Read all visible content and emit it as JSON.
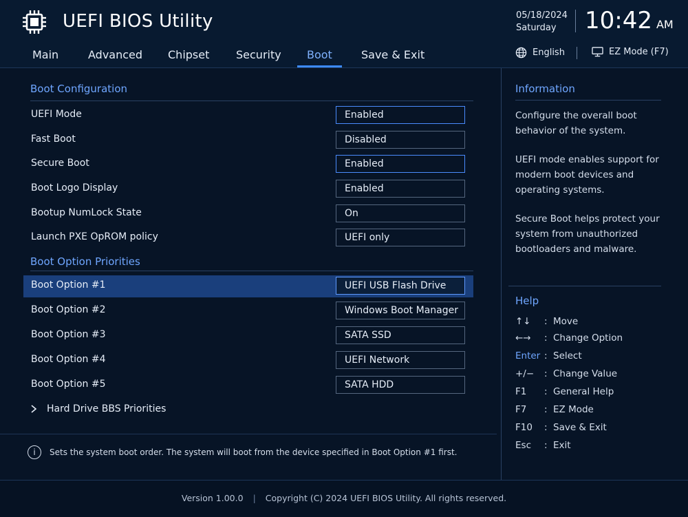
{
  "header": {
    "title": "UEFI BIOS Utility",
    "date": "05/18/2024",
    "day": "Saturday",
    "time": "10:42",
    "ampm": "AM",
    "language": "English",
    "ez_mode": "EZ Mode (F7)",
    "chip_icon": "cpu-chip-icon",
    "globe_icon": "globe-icon",
    "monitor_icon": "monitor-icon"
  },
  "tabs": [
    {
      "label": "Main",
      "active": false
    },
    {
      "label": "Advanced",
      "active": false
    },
    {
      "label": "Chipset",
      "active": false
    },
    {
      "label": "Security",
      "active": false
    },
    {
      "label": "Boot",
      "active": true
    },
    {
      "label": "Save & Exit",
      "active": false
    }
  ],
  "main": {
    "boot_config_title": "Boot Configuration",
    "settings": [
      {
        "label": "UEFI Mode",
        "value": "Enabled"
      },
      {
        "label": "Fast Boot",
        "value": "Disabled"
      },
      {
        "label": "Secure Boot",
        "value": "Enabled"
      },
      {
        "label": "Boot Logo Display",
        "value": "Enabled"
      },
      {
        "label": "Bootup NumLock State",
        "value": "On"
      },
      {
        "label": "Launch PXE OpROM policy",
        "value": "UEFI only"
      }
    ],
    "priorities_title": "Boot Option Priorities",
    "boot_options": [
      {
        "label": "Boot Option #1",
        "value": "UEFI USB Flash Drive",
        "selected": true
      },
      {
        "label": "Boot Option #2",
        "value": "Windows Boot Manager"
      },
      {
        "label": "Boot Option #3",
        "value": "SATA SSD"
      },
      {
        "label": "Boot Option #4",
        "value": "UEFI Network"
      },
      {
        "label": "Boot Option #5",
        "value": "SATA HDD"
      }
    ],
    "submenu": "Hard Drive BBS Priorities",
    "hint": "Sets the system boot order. The system will boot from the device specified in Boot Option #1 first."
  },
  "side": {
    "info_title": "Information",
    "info_paragraphs": [
      "Configure the overall boot behavior of the system.",
      "UEFI mode enables support for modern boot devices and operating systems.",
      "Secure Boot helps protect your system from unauthorized bootloaders and malware."
    ],
    "help_title": "Help",
    "help": [
      {
        "key": "↑↓",
        "desc": "Move"
      },
      {
        "key": "←→",
        "desc": "Change Option"
      },
      {
        "key": "Enter",
        "desc": "Select"
      },
      {
        "key": "+/−",
        "desc": "Change Value"
      },
      {
        "key": "F1",
        "desc": "General Help"
      },
      {
        "key": "F7",
        "desc": "EZ Mode"
      },
      {
        "key": "F10",
        "desc": "Save & Exit"
      },
      {
        "key": "Esc",
        "desc": "Exit"
      }
    ]
  },
  "footer": {
    "version": "Version 1.00.0",
    "copyright": "Copyright (C) 2024 UEFI BIOS Utility. All rights reserved."
  },
  "colors": {
    "background": "#071426",
    "accent": "#6fa6ff",
    "selected_row": "#1a3f7c"
  }
}
